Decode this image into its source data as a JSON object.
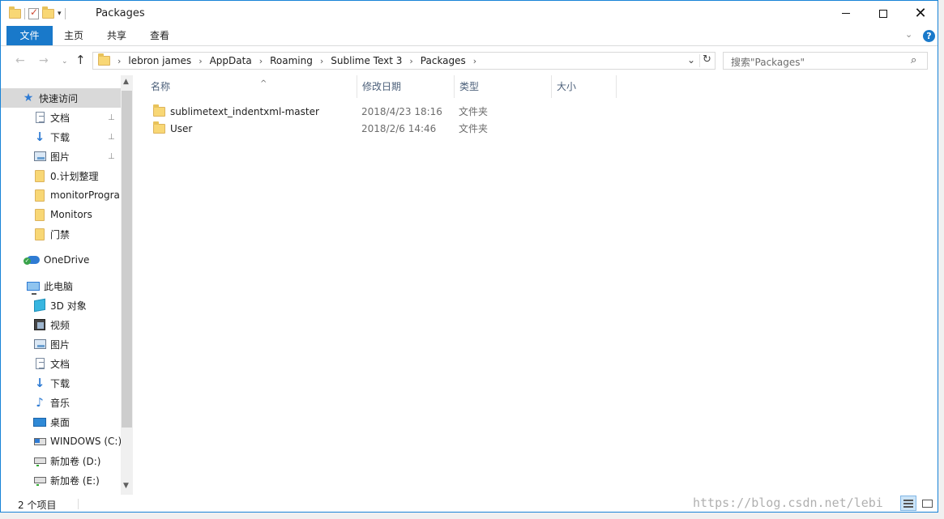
{
  "window": {
    "title": "Packages",
    "controls": {
      "minimize": "",
      "maximize": "",
      "close": "✕"
    }
  },
  "ribbon": {
    "tabs": [
      "文件",
      "主页",
      "共享",
      "查看"
    ],
    "expand_icon": "chevron-down-icon",
    "help_icon": "?"
  },
  "address": {
    "crumbs": [
      "lebron james",
      "AppData",
      "Roaming",
      "Sublime Text 3",
      "Packages"
    ],
    "separator": "›",
    "dropdown": "⌄",
    "refresh": "↻"
  },
  "search": {
    "placeholder": "搜索\"Packages\"",
    "icon": "⌕"
  },
  "nav_buttons": {
    "back": "←",
    "forward": "→",
    "recent": "⌄",
    "up": "↑"
  },
  "navpane": {
    "items": [
      {
        "label": "快速访问",
        "icon": "star-icon",
        "pinned": false,
        "selected": true
      },
      {
        "label": "文档",
        "icon": "document-icon",
        "pinned": true
      },
      {
        "label": "下载",
        "icon": "download-icon",
        "pinned": true
      },
      {
        "label": "图片",
        "icon": "picture-icon",
        "pinned": true
      },
      {
        "label": "0.计划整理",
        "icon": "folder-icon",
        "pinned": false
      },
      {
        "label": "monitorProgra",
        "icon": "folder-icon",
        "pinned": false
      },
      {
        "label": "Monitors",
        "icon": "folder-icon",
        "pinned": false
      },
      {
        "label": "门禁",
        "icon": "folder-icon",
        "pinned": false
      },
      {
        "label": "OneDrive",
        "icon": "onedrive-icon",
        "pinned": false
      },
      {
        "label": "此电脑",
        "icon": "computer-icon",
        "pinned": false
      },
      {
        "label": "3D 对象",
        "icon": "3d-objects-icon",
        "pinned": false
      },
      {
        "label": "视频",
        "icon": "video-icon",
        "pinned": false
      },
      {
        "label": "图片",
        "icon": "picture-icon",
        "pinned": false
      },
      {
        "label": "文档",
        "icon": "document-icon",
        "pinned": false
      },
      {
        "label": "下载",
        "icon": "download-icon",
        "pinned": false
      },
      {
        "label": "音乐",
        "icon": "music-icon",
        "pinned": false
      },
      {
        "label": "桌面",
        "icon": "desktop-icon",
        "pinned": false
      },
      {
        "label": "WINDOWS (C:)",
        "icon": "windows-drive-icon",
        "pinned": false
      },
      {
        "label": "新加卷 (D:)",
        "icon": "drive-icon",
        "pinned": false
      },
      {
        "label": "新加卷 (E:)",
        "icon": "drive-icon",
        "pinned": false
      }
    ],
    "pin_glyph": "📌"
  },
  "filelist": {
    "columns": [
      "名称",
      "修改日期",
      "类型",
      "大小"
    ],
    "sort_glyph": "^",
    "rows": [
      {
        "name": "sublimetext_indentxml-master",
        "date": "2018/4/23 18:16",
        "type": "文件夹",
        "size": ""
      },
      {
        "name": "User",
        "date": "2018/2/6 14:46",
        "type": "文件夹",
        "size": ""
      }
    ]
  },
  "status": {
    "count": "2 个项目"
  },
  "watermark": "https://blog.csdn.net/lebi",
  "colors": {
    "accent": "#1979ca",
    "border": "#1883d7",
    "selected_bg": "#d9d9d9"
  }
}
